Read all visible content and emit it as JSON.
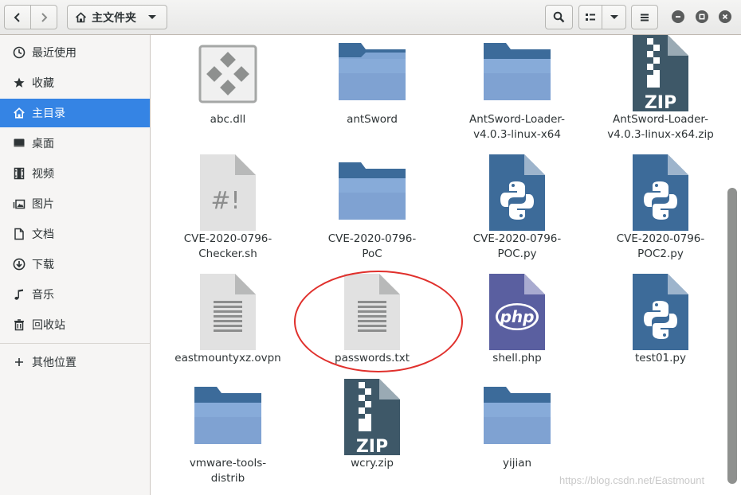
{
  "header": {
    "path_label": "主文件夹"
  },
  "sidebar": {
    "items": [
      {
        "label": "最近使用",
        "icon": "clock-icon",
        "active": false
      },
      {
        "label": "收藏",
        "icon": "star-icon",
        "active": false
      },
      {
        "label": "主目录",
        "icon": "home-icon",
        "active": true
      },
      {
        "label": "桌面",
        "icon": "desktop-icon",
        "active": false
      },
      {
        "label": "视频",
        "icon": "film-icon",
        "active": false
      },
      {
        "label": "图片",
        "icon": "image-icon",
        "active": false
      },
      {
        "label": "文档",
        "icon": "document-icon",
        "active": false
      },
      {
        "label": "下载",
        "icon": "download-icon",
        "active": false
      },
      {
        "label": "音乐",
        "icon": "music-icon",
        "active": false
      },
      {
        "label": "回收站",
        "icon": "trash-icon",
        "active": false
      }
    ],
    "other_locations": "其他位置"
  },
  "files": [
    {
      "name": "abc.dll",
      "type": "dll"
    },
    {
      "name": "antSword",
      "type": "folder"
    },
    {
      "name": "AntSword-Loader-\nv4.0.3-linux-x64",
      "type": "folder"
    },
    {
      "name": "AntSword-Loader-\nv4.0.3-linux-x64.zip",
      "type": "zip"
    },
    {
      "name": "CVE-2020-0796-\nChecker.sh",
      "type": "script"
    },
    {
      "name": "CVE-2020-0796-\nPoC",
      "type": "folder"
    },
    {
      "name": "CVE-2020-0796-\nPOC.py",
      "type": "python"
    },
    {
      "name": "CVE-2020-0796-\nPOC2.py",
      "type": "python"
    },
    {
      "name": "eastmountyxz.ovpn",
      "type": "text"
    },
    {
      "name": "passwords.txt",
      "type": "text"
    },
    {
      "name": "shell.php",
      "type": "php"
    },
    {
      "name": "test01.py",
      "type": "python"
    },
    {
      "name": "vmware-tools-\ndistrib",
      "type": "folder"
    },
    {
      "name": "wcry.zip",
      "type": "zip"
    },
    {
      "name": "yijian",
      "type": "folder"
    }
  ],
  "icon_text": {
    "zip": "ZIP",
    "php": "php",
    "script": "#!"
  },
  "watermark": "https://blog.csdn.net/Eastmount",
  "colors": {
    "accent": "#3584e4",
    "annotation": "#e0302c",
    "folder": "#6f94c6",
    "python_doc": "#3d6b99"
  }
}
